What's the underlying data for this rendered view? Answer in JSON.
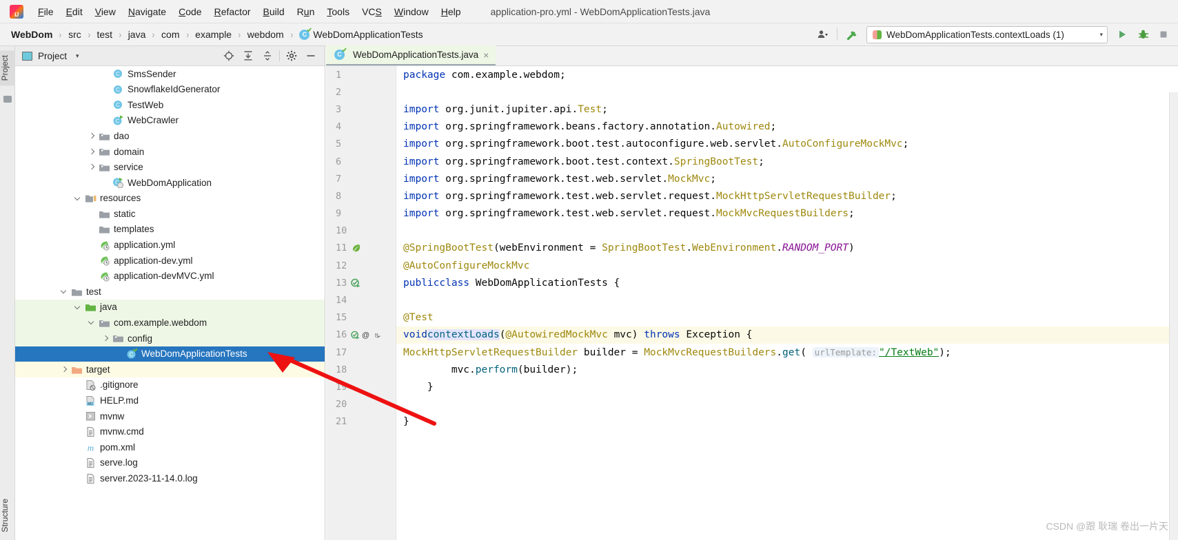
{
  "window": {
    "title": "application-pro.yml - WebDomApplicationTests.java",
    "logo": "intellij-idea-logo"
  },
  "menubar": {
    "items": [
      {
        "label": "File",
        "mnemonic": "F"
      },
      {
        "label": "Edit",
        "mnemonic": "E"
      },
      {
        "label": "View",
        "mnemonic": "V"
      },
      {
        "label": "Navigate",
        "mnemonic": "N"
      },
      {
        "label": "Code",
        "mnemonic": "C"
      },
      {
        "label": "Refactor",
        "mnemonic": "R"
      },
      {
        "label": "Build",
        "mnemonic": "B"
      },
      {
        "label": "Run",
        "mnemonic": "u"
      },
      {
        "label": "Tools",
        "mnemonic": "T"
      },
      {
        "label": "VCS",
        "mnemonic": "S"
      },
      {
        "label": "Window",
        "mnemonic": "W"
      },
      {
        "label": "Help",
        "mnemonic": "H"
      }
    ]
  },
  "navbar": {
    "crumbs": [
      {
        "label": "WebDom",
        "type": "project"
      },
      {
        "label": "src",
        "type": "folder"
      },
      {
        "label": "test",
        "type": "folder"
      },
      {
        "label": "java",
        "type": "folder"
      },
      {
        "label": "com",
        "type": "package"
      },
      {
        "label": "example",
        "type": "package"
      },
      {
        "label": "webdom",
        "type": "package"
      },
      {
        "label": "WebDomApplicationTests",
        "type": "class"
      }
    ],
    "separator": "›",
    "actions": [
      {
        "name": "user-settings-icon",
        "label": ""
      },
      {
        "name": "build-hammer-icon",
        "label": ""
      }
    ],
    "run_configuration": {
      "label": "WebDomApplicationTests.contextLoads (1)",
      "caret": "▾"
    },
    "run_buttons": [
      {
        "name": "run-button",
        "label": "▶",
        "color": "#59a869"
      },
      {
        "name": "debug-button",
        "label": "",
        "color": "#40b6e0"
      },
      {
        "name": "stop-button",
        "label": "",
        "color": "#9aa0a6"
      }
    ]
  },
  "left_strip": {
    "project_tab": "Project",
    "structure_tab": "Structure"
  },
  "project_panel": {
    "title": "Project",
    "caret": "▾",
    "actions": [
      {
        "name": "locate-in-tree-icon"
      },
      {
        "name": "expand-all-icon"
      },
      {
        "name": "collapse-all-icon"
      },
      {
        "name": "settings-gear-icon"
      },
      {
        "name": "hide-panel-icon"
      }
    ],
    "tree": [
      {
        "label": "SmsSender",
        "indent": 6,
        "arrow": "none",
        "icon": "java-class",
        "state": "normal"
      },
      {
        "label": "SnowflakeIdGenerator",
        "indent": 6,
        "arrow": "none",
        "icon": "java-class",
        "state": "normal"
      },
      {
        "label": "TestWeb",
        "indent": 6,
        "arrow": "none",
        "icon": "java-class",
        "state": "normal"
      },
      {
        "label": "WebCrawler",
        "indent": 6,
        "arrow": "none",
        "icon": "java-class-runnable",
        "state": "normal"
      },
      {
        "label": "dao",
        "indent": 5,
        "arrow": "right",
        "icon": "package",
        "state": "normal"
      },
      {
        "label": "domain",
        "indent": 5,
        "arrow": "right",
        "icon": "package",
        "state": "normal"
      },
      {
        "label": "service",
        "indent": 5,
        "arrow": "right",
        "icon": "package",
        "state": "normal"
      },
      {
        "label": "WebDomApplication",
        "indent": 6,
        "arrow": "none",
        "icon": "spring-class",
        "state": "normal"
      },
      {
        "label": "resources",
        "indent": 4,
        "arrow": "down",
        "icon": "resources-folder",
        "state": "normal"
      },
      {
        "label": "static",
        "indent": 5,
        "arrow": "none",
        "icon": "folder",
        "state": "normal"
      },
      {
        "label": "templates",
        "indent": 5,
        "arrow": "none",
        "icon": "folder",
        "state": "normal"
      },
      {
        "label": "application.yml",
        "indent": 5,
        "arrow": "none",
        "icon": "spring-yaml",
        "state": "normal"
      },
      {
        "label": "application-dev.yml",
        "indent": 5,
        "arrow": "none",
        "icon": "spring-yaml",
        "state": "normal"
      },
      {
        "label": "application-devMVC.yml",
        "indent": 5,
        "arrow": "none",
        "icon": "spring-yaml",
        "state": "normal"
      },
      {
        "label": "test",
        "indent": 3,
        "arrow": "down",
        "icon": "folder",
        "state": "normal"
      },
      {
        "label": "java",
        "indent": 4,
        "arrow": "down",
        "icon": "test-source-folder",
        "state": "src-test"
      },
      {
        "label": "com.example.webdom",
        "indent": 5,
        "arrow": "down",
        "icon": "package",
        "state": "src-test"
      },
      {
        "label": "config",
        "indent": 6,
        "arrow": "right",
        "icon": "package",
        "state": "src-test"
      },
      {
        "label": "WebDomApplicationTests",
        "indent": 7,
        "arrow": "none",
        "icon": "test-class",
        "state": "selected"
      },
      {
        "label": "target",
        "indent": 3,
        "arrow": "right",
        "icon": "excluded-folder",
        "state": "excluded"
      },
      {
        "label": ".gitignore",
        "indent": 4,
        "arrow": "none",
        "icon": "gitignore-file",
        "state": "normal"
      },
      {
        "label": "HELP.md",
        "indent": 4,
        "arrow": "none",
        "icon": "markdown-file",
        "state": "normal"
      },
      {
        "label": "mvnw",
        "indent": 4,
        "arrow": "none",
        "icon": "shell-file",
        "state": "normal"
      },
      {
        "label": "mvnw.cmd",
        "indent": 4,
        "arrow": "none",
        "icon": "text-file",
        "state": "normal"
      },
      {
        "label": "pom.xml",
        "indent": 4,
        "arrow": "none",
        "icon": "maven-file",
        "state": "normal"
      },
      {
        "label": "serve.log",
        "indent": 4,
        "arrow": "none",
        "icon": "text-file",
        "state": "normal"
      },
      {
        "label": "server.2023-11-14.0.log",
        "indent": 4,
        "arrow": "none",
        "icon": "text-file",
        "state": "normal"
      }
    ]
  },
  "editor": {
    "tab": {
      "label": "WebDomApplicationTests.java",
      "icon": "test-class-icon",
      "close": "×"
    },
    "line_numbers": [
      "1",
      "2",
      "3",
      "4",
      "5",
      "6",
      "7",
      "8",
      "9",
      "10",
      "11",
      "12",
      "13",
      "14",
      "15",
      "16",
      "17",
      "18",
      "19",
      "20",
      "21"
    ],
    "gutter_icons": {
      "11": [
        "spring-leaf-icon"
      ],
      "13": [
        "run-test-class-icon"
      ],
      "16": [
        "run-test-method-icon",
        "annotation-at-icon",
        "spring-bean-icon"
      ]
    },
    "current_line": 16,
    "code_lines": [
      "package com.example.webdom;",
      "",
      "import org.junit.jupiter.api.Test;",
      "import org.springframework.beans.factory.annotation.Autowired;",
      "import org.springframework.boot.test.autoconfigure.web.servlet.AutoConfigureMockMvc;",
      "import org.springframework.boot.test.context.SpringBootTest;",
      "import org.springframework.test.web.servlet.MockMvc;",
      "import org.springframework.test.web.servlet.request.MockHttpServletRequestBuilder;",
      "import org.springframework.test.web.servlet.request.MockMvcRequestBuilders;",
      "",
      "@SpringBootTest(webEnvironment = SpringBootTest.WebEnvironment.RANDOM_PORT)",
      "@AutoConfigureMockMvc",
      "public class WebDomApplicationTests {",
      "",
      "    @Test",
      "    void contextLoads(@Autowired MockMvc mvc) throws Exception {",
      "        MockHttpServletRequestBuilder builder = MockMvcRequestBuilders.get( urlTemplate: \"/TextWeb\");",
      "        mvc.perform(builder);",
      "    }",
      "",
      "}"
    ],
    "inlay_hint": "urlTemplate:",
    "string_literal": "\"/TextWeb\""
  },
  "annotation": {
    "arrow_color": "#ee1111"
  },
  "watermark": {
    "text": "CSDN @跟 耿瑞 卷出一片天"
  },
  "colors": {
    "selection_blue": "#2675bf",
    "test_source_green": "#eef7e6",
    "excluded_yellow": "#fdfbe4",
    "keyword_blue": "#0033b3",
    "annotation_olive": "#9e880d",
    "string_green": "#067d17",
    "constant_purple": "#871094",
    "current_line": "#fcf9e6"
  }
}
